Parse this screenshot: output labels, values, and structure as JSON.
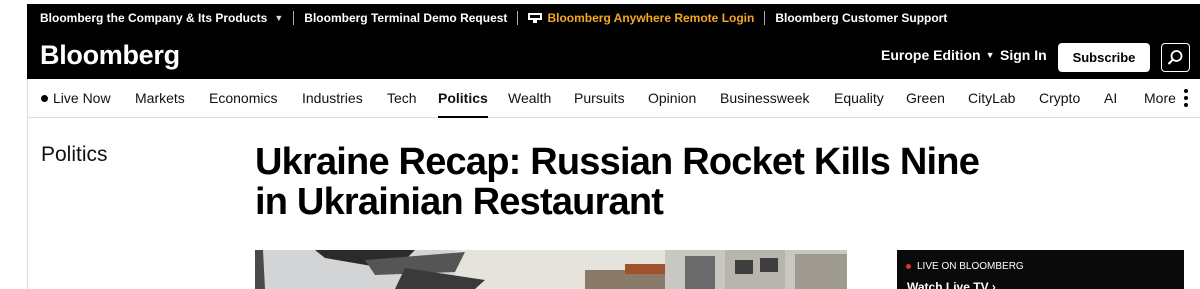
{
  "topbar": {
    "company_label": "Bloomberg the Company & Its Products",
    "terminal_label": "Bloomberg Terminal Demo Request",
    "anywhere_label": "Bloomberg Anywhere Remote Login",
    "support_label": "Bloomberg Customer Support"
  },
  "header": {
    "logo": "Bloomberg",
    "edition_label": "Europe Edition",
    "signin_label": "Sign In",
    "subscribe_label": "Subscribe"
  },
  "nav": {
    "items": [
      {
        "label": "Live Now"
      },
      {
        "label": "Markets"
      },
      {
        "label": "Economics"
      },
      {
        "label": "Industries"
      },
      {
        "label": "Tech"
      },
      {
        "label": "Politics"
      },
      {
        "label": "Wealth"
      },
      {
        "label": "Pursuits"
      },
      {
        "label": "Opinion"
      },
      {
        "label": "Businessweek"
      },
      {
        "label": "Equality"
      },
      {
        "label": "Green"
      },
      {
        "label": "CityLab"
      },
      {
        "label": "Crypto"
      },
      {
        "label": "AI"
      },
      {
        "label": "More"
      }
    ],
    "active": "Politics"
  },
  "article": {
    "section": "Politics",
    "headline_line1": "Ukraine Recap: Russian Rocket Kills Nine",
    "headline_line2": "in Ukrainian Restaurant"
  },
  "live_panel": {
    "label": "LIVE ON BLOOMBERG",
    "watch_label": "Watch Live TV"
  },
  "colors": {
    "header_bg": "#000000",
    "accent_orange": "#f5a623",
    "live_dot": "#e52e2e"
  }
}
